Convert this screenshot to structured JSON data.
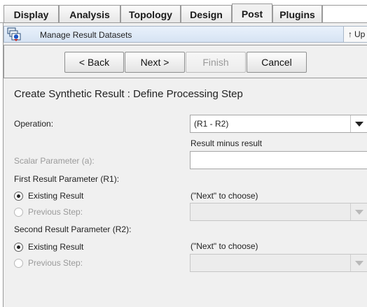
{
  "tabs": [
    {
      "label": "Display",
      "active": false
    },
    {
      "label": "Analysis",
      "active": false
    },
    {
      "label": "Topology",
      "active": false
    },
    {
      "label": "Design",
      "active": false
    },
    {
      "label": "Post",
      "active": true
    },
    {
      "label": "Plugins",
      "active": false
    }
  ],
  "panel": {
    "title": "Manage Result Datasets",
    "up_label": "Up",
    "up_icon": "up-arrow-icon",
    "title_icon": "dataset-manage-icon"
  },
  "wizard": {
    "back_label": "< Back",
    "next_label": "Next >",
    "finish_label": "Finish",
    "cancel_label": "Cancel",
    "finish_enabled": false
  },
  "form": {
    "heading": "Create Synthetic Result : Define Processing Step",
    "operation_label": "Operation:",
    "operation_value": "(R1 - R2)",
    "operation_description": "Result minus result",
    "scalar_label": "Scalar Parameter (a):",
    "scalar_value": "",
    "first_param_label": "First Result Parameter (R1):",
    "first_existing_label": "Existing Result",
    "first_existing_hint": "(\"Next\" to choose)",
    "first_previous_label": "Previous Step:",
    "first_selected": "existing",
    "second_param_label": "Second Result Parameter (R2):",
    "second_existing_label": "Existing Result",
    "second_existing_hint": "(\"Next\" to choose)",
    "second_previous_label": "Previous Step:",
    "second_selected": "existing"
  },
  "colors": {
    "panel_bg": "#f0f0f0",
    "titlebar_bg": "#dce7f5",
    "disabled_text": "#9a9a9a"
  }
}
